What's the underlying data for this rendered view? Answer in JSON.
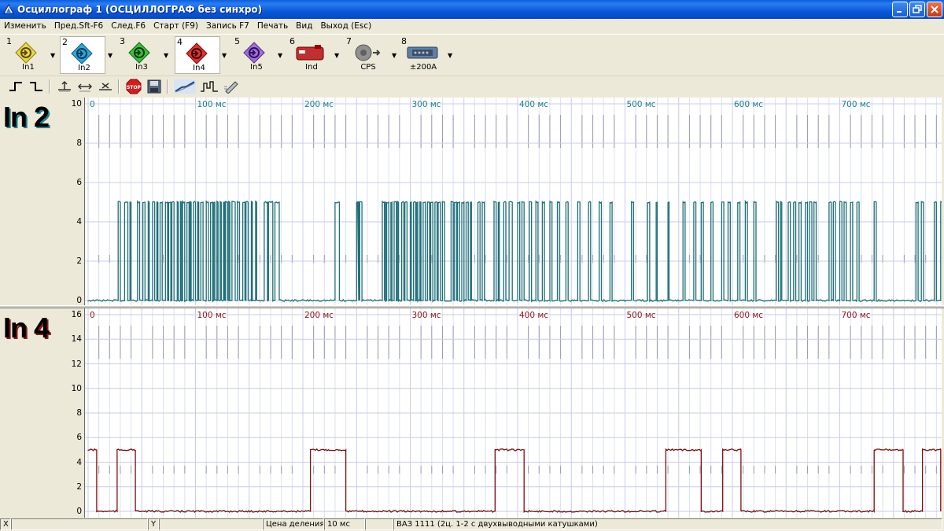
{
  "window": {
    "title": "Осциллограф 1 (ОСЦИЛЛОГРАФ без синхро)"
  },
  "menu": [
    "Изменить",
    "Пред.Sft-F6",
    "След.F6",
    "Старт (F9)",
    "Запись F7",
    "Печать",
    "Вид",
    "Выход (Esc)"
  ],
  "channels": [
    {
      "num": "1",
      "label": "In1",
      "icon": "probe-yellow-icon",
      "color": "#e8d84a"
    },
    {
      "num": "2",
      "label": "In2",
      "icon": "probe-cyan-icon",
      "color": "#2ca8d8",
      "active": true
    },
    {
      "num": "3",
      "label": "In3",
      "icon": "probe-green-icon",
      "color": "#3cc040"
    },
    {
      "num": "4",
      "label": "In4",
      "icon": "probe-red-icon",
      "color": "#e03030",
      "active": true
    },
    {
      "num": "5",
      "label": "In5",
      "icon": "probe-purple-icon",
      "color": "#a070d8"
    },
    {
      "num": "6",
      "label": "Ind",
      "icon": "inductive-clamp-icon",
      "color": "#c03030"
    },
    {
      "num": "7",
      "label": "CPS",
      "icon": "cps-sensor-icon",
      "color": "#808080"
    },
    {
      "num": "8",
      "label": "±200A",
      "icon": "current-clamp-icon",
      "color": "#6080a0"
    }
  ],
  "tools": [
    "rising-edge-icon",
    "falling-edge-icon",
    "zoom-in-vertical-icon",
    "zoom-out-vertical-icon",
    "auto-scale-icon",
    "stop-icon",
    "save-icon",
    "smooth-icon",
    "digital-icon",
    "pen-icon"
  ],
  "time_labels": [
    "0",
    "100 мс",
    "200 мс",
    "300 мс",
    "400 мс",
    "500 мс",
    "600 мс",
    "700 мс"
  ],
  "panels": [
    {
      "name": "In 2",
      "line_color": "#1e6e78",
      "label_color": "#1e7f8f",
      "y_ticks": [
        "10",
        "8",
        "6",
        "4",
        "2",
        "0"
      ]
    },
    {
      "name": "In 4",
      "line_color": "#7a1010",
      "label_color": "#8b1a1a",
      "y_ticks": [
        "16",
        "14",
        "12",
        "10",
        "8",
        "6",
        "4",
        "2",
        "0"
      ]
    }
  ],
  "chart_data": [
    {
      "type": "line",
      "series": [
        {
          "name": "In 2",
          "pulses_ms": [
            [
              28,
              30
            ],
            [
              34,
              37
            ],
            [
              39,
              40
            ],
            [
              46,
              48
            ],
            [
              51,
              53
            ],
            [
              56,
              57
            ],
            [
              60,
              62
            ],
            [
              64,
              65
            ],
            [
              67,
              69
            ],
            [
              72,
              74
            ],
            [
              75,
              77
            ],
            [
              78,
              80
            ],
            [
              83,
              84
            ],
            [
              86,
              87
            ],
            [
              88,
              90
            ],
            [
              92,
              94
            ],
            [
              95,
              96
            ],
            [
              98,
              100
            ],
            [
              102,
              103
            ],
            [
              105,
              107
            ],
            [
              110,
              112
            ],
            [
              114,
              116
            ],
            [
              117,
              118
            ],
            [
              120,
              121
            ],
            [
              123,
              124
            ],
            [
              126,
              127
            ],
            [
              128,
              130
            ],
            [
              131,
              132
            ],
            [
              134,
              137
            ],
            [
              139,
              141
            ],
            [
              144,
              146
            ],
            [
              147,
              149
            ],
            [
              152,
              153
            ],
            [
              156,
              157
            ],
            [
              164,
              167
            ],
            [
              168,
              172
            ],
            [
              174,
              178
            ],
            [
              230,
              234
            ],
            [
              250,
              252
            ],
            [
              251,
              253
            ],
            [
              253,
              255
            ],
            [
              274,
              276
            ],
            [
              276,
              277
            ],
            [
              278,
              280
            ],
            [
              282,
              283
            ],
            [
              285,
              287
            ],
            [
              288,
              289
            ],
            [
              292,
              294
            ],
            [
              295,
              297
            ],
            [
              300,
              301
            ],
            [
              303,
              305
            ],
            [
              306,
              307
            ],
            [
              309,
              310
            ],
            [
              312,
              314
            ],
            [
              316,
              318
            ],
            [
              319,
              321
            ],
            [
              323,
              325
            ],
            [
              326,
              328
            ],
            [
              330,
              332
            ],
            [
              338,
              340
            ],
            [
              341,
              343
            ],
            [
              344,
              346
            ],
            [
              348,
              350
            ],
            [
              352,
              354
            ],
            [
              356,
              357
            ],
            [
              363,
              365
            ],
            [
              367,
              369
            ],
            [
              378,
              380
            ],
            [
              382,
              383
            ],
            [
              387,
              389
            ],
            [
              392,
              395
            ],
            [
              400,
              402
            ],
            [
              404,
              406
            ],
            [
              411,
              413
            ],
            [
              417,
              419
            ],
            [
              423,
              425
            ],
            [
              430,
              432
            ],
            [
              437,
              439
            ],
            [
              445,
              447
            ],
            [
              456,
              458
            ],
            [
              466,
              468
            ],
            [
              476,
              478
            ],
            [
              486,
              488
            ],
            [
              506,
              508
            ],
            [
              521,
              523
            ],
            [
              529,
              530
            ],
            [
              540,
              541
            ],
            [
              554,
              556
            ],
            [
              564,
              566
            ],
            [
              571,
              573
            ],
            [
              580,
              582
            ],
            [
              590,
              592
            ],
            [
              596,
              598
            ],
            [
              605,
              607
            ],
            [
              612,
              614
            ],
            [
              620,
              622
            ],
            [
              641,
              643
            ],
            [
              645,
              646
            ],
            [
              652,
              654
            ],
            [
              657,
              659
            ],
            [
              662,
              664
            ],
            [
              668,
              670
            ],
            [
              672,
              674
            ],
            [
              676,
              678
            ],
            [
              690,
              692
            ],
            [
              694,
              696
            ],
            [
              700,
              702
            ],
            [
              704,
              706
            ],
            [
              710,
              712
            ],
            [
              716,
              718
            ],
            [
              732,
              734
            ],
            [
              771,
              773
            ],
            [
              776,
              778
            ],
            [
              788,
              790
            ],
            [
              794,
              797
            ]
          ]
        }
      ],
      "ylim": [
        0,
        10
      ],
      "high": 5,
      "low": 0,
      "xlim_ms": [
        0,
        790
      ]
    },
    {
      "type": "line",
      "series": [
        {
          "name": "In 4",
          "pulses_ms": [
            [
              0,
              8
            ],
            [
              27,
              44
            ],
            [
              207,
              240
            ],
            [
              379,
              406
            ],
            [
              538,
              571
            ],
            [
              591,
              608
            ],
            [
              732,
              759
            ],
            [
              777,
              794
            ]
          ]
        }
      ],
      "ylim": [
        0,
        16
      ],
      "high": 5,
      "low": 0,
      "xlim_ms": [
        0,
        790
      ]
    }
  ],
  "status": {
    "x_label": "X",
    "y_label": "Y",
    "division_label": "Цена деления",
    "division_value": "10 мс",
    "engine": "ВАЗ 1111 (2ц. 1-2 с двухвыводными катушками)"
  }
}
